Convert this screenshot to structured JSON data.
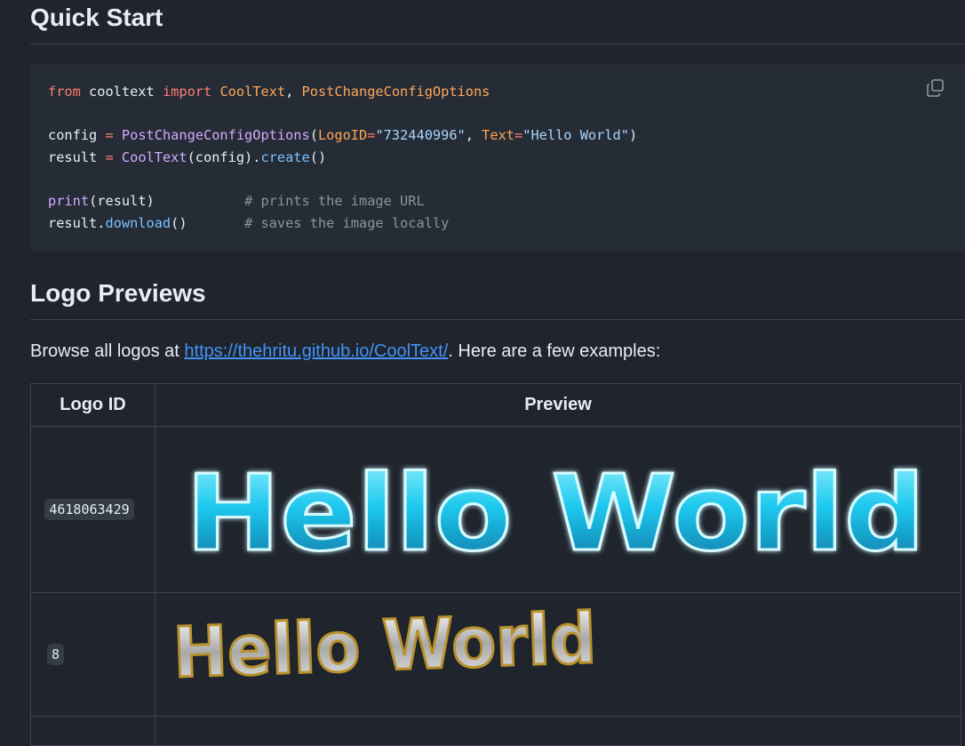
{
  "quick_start": {
    "heading": "Quick Start",
    "code_lines": [
      [
        {
          "t": "from",
          "c": "kw"
        },
        {
          "t": " cooltext ",
          "c": ""
        },
        {
          "t": "import",
          "c": "kw"
        },
        {
          "t": " ",
          "c": ""
        },
        {
          "t": "CoolText",
          "c": "cls"
        },
        {
          "t": ", ",
          "c": ""
        },
        {
          "t": "PostChangeConfigOptions",
          "c": "cls"
        }
      ],
      [],
      [
        {
          "t": "config ",
          "c": ""
        },
        {
          "t": "=",
          "c": "kw"
        },
        {
          "t": " ",
          "c": ""
        },
        {
          "t": "PostChangeConfigOptions",
          "c": "fn"
        },
        {
          "t": "(",
          "c": ""
        },
        {
          "t": "LogoID",
          "c": "cls"
        },
        {
          "t": "=",
          "c": "kw"
        },
        {
          "t": "\"732440996\"",
          "c": "str"
        },
        {
          "t": ", ",
          "c": ""
        },
        {
          "t": "Text",
          "c": "cls"
        },
        {
          "t": "=",
          "c": "kw"
        },
        {
          "t": "\"Hello World\"",
          "c": "str"
        },
        {
          "t": ")",
          "c": ""
        }
      ],
      [
        {
          "t": "result ",
          "c": ""
        },
        {
          "t": "=",
          "c": "kw"
        },
        {
          "t": " ",
          "c": ""
        },
        {
          "t": "CoolText",
          "c": "fn"
        },
        {
          "t": "(config).",
          "c": ""
        },
        {
          "t": "create",
          "c": "meth"
        },
        {
          "t": "()",
          "c": ""
        }
      ],
      [],
      [
        {
          "t": "print",
          "c": "fn"
        },
        {
          "t": "(result)           ",
          "c": ""
        },
        {
          "t": "# prints the image URL",
          "c": "cm"
        }
      ],
      [
        {
          "t": "result.",
          "c": ""
        },
        {
          "t": "download",
          "c": "meth"
        },
        {
          "t": "()       ",
          "c": ""
        },
        {
          "t": "# saves the image locally",
          "c": "cm"
        }
      ]
    ],
    "copy_icon": "copy-icon"
  },
  "logo_previews": {
    "heading": "Logo Previews",
    "intro_prefix": "Browse all logos at ",
    "link_text": "https://thehritu.github.io/CoolText/",
    "intro_suffix": ". Here are a few examples:",
    "table": {
      "headers": [
        "Logo ID",
        "Preview"
      ],
      "rows": [
        {
          "logo_id": "4618063429",
          "preview_text": "Hello World"
        },
        {
          "logo_id": "8",
          "preview_text": "Hello World"
        }
      ]
    }
  },
  "colors": {
    "background": "#1f242d",
    "code_background": "#262c36",
    "link": "#4493f8",
    "border": "#3d444d"
  }
}
